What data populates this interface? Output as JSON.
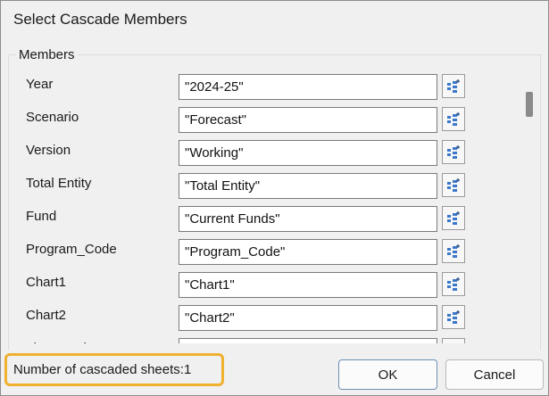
{
  "window": {
    "title": "Select Cascade Members"
  },
  "members": {
    "group_label": "Members",
    "rows": [
      {
        "label": "Year",
        "value": "\"2024-25\""
      },
      {
        "label": "Scenario",
        "value": "\"Forecast\""
      },
      {
        "label": "Version",
        "value": "\"Working\""
      },
      {
        "label": "Total Entity",
        "value": "\"Total Entity\""
      },
      {
        "label": "Fund",
        "value": "\"Current Funds\""
      },
      {
        "label": "Program_Code",
        "value": "\"Program_Code\""
      },
      {
        "label": "Chart1",
        "value": "\"Chart1\""
      },
      {
        "label": "Chart2",
        "value": "\"Chart2\""
      },
      {
        "label": "Time_Series",
        "value": "\"Time_Series\""
      }
    ],
    "member_button_icon": "member-selector-icon"
  },
  "status": {
    "label": "Number of cascaded sheets:",
    "count": "1"
  },
  "buttons": {
    "ok_label": "OK",
    "cancel_label": "Cancel"
  },
  "colors": {
    "highlight_border": "#f0b030",
    "accent_icon": "#3b78c9"
  }
}
